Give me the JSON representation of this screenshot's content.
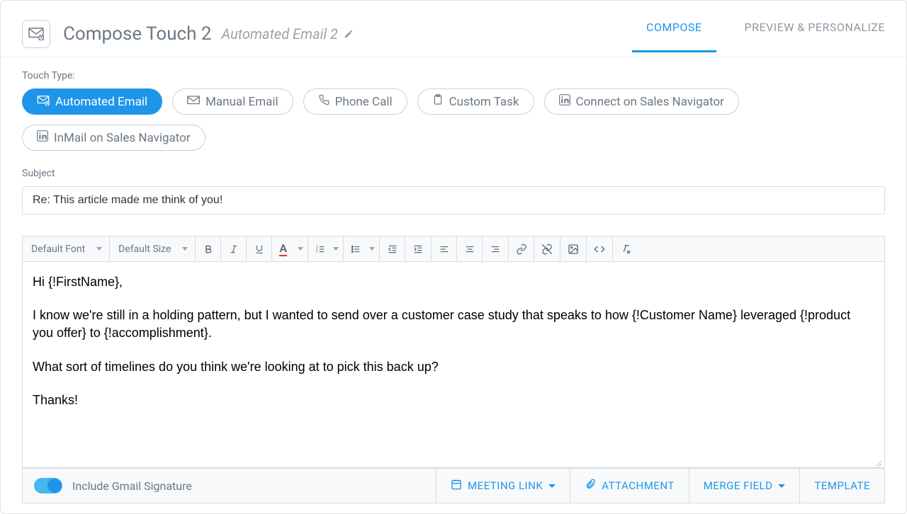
{
  "header": {
    "title": "Compose Touch 2",
    "subtitle": "Automated Email 2"
  },
  "tabs": {
    "compose": "COMPOSE",
    "preview": "PREVIEW & PERSONALIZE"
  },
  "touch_type": {
    "label": "Touch Type:",
    "options": {
      "automated_email": "Automated Email",
      "manual_email": "Manual Email",
      "phone_call": "Phone Call",
      "custom_task": "Custom Task",
      "connect_sales_nav": "Connect on Sales Navigator",
      "inmail_sales_nav": "InMail on Sales Navigator"
    }
  },
  "subject": {
    "label": "Subject",
    "value": "Re: This article made me think of you!"
  },
  "toolbar": {
    "font": "Default Font",
    "size": "Default Size"
  },
  "email_body": {
    "p1": "Hi {!FirstName},",
    "p2": "I know we're still in a holding pattern, but I wanted to send over a customer case study that speaks to how {!Customer Name} leveraged {!product you offer} to {!accomplishment}.",
    "p3": "What sort of timelines do you think we're looking at to pick this back up?",
    "p4": "Thanks!"
  },
  "footer": {
    "signature_label": "Include Gmail Signature",
    "meeting_link": "MEETING LINK",
    "attachment": "ATTACHMENT",
    "merge_field": "MERGE FIELD",
    "template": "TEMPLATE"
  }
}
